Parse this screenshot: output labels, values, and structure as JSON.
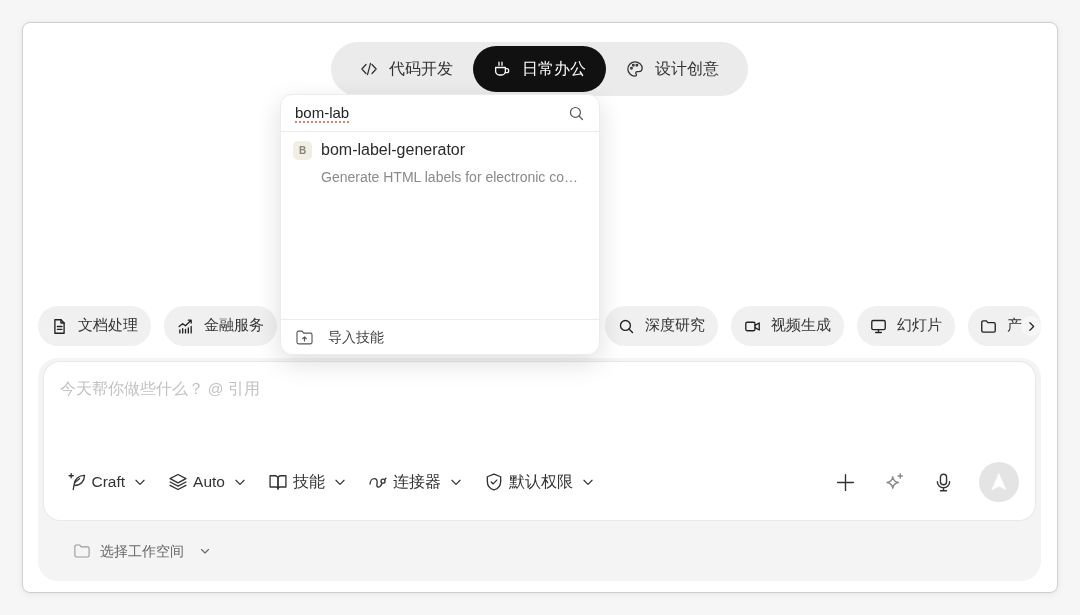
{
  "mode_tabs": [
    {
      "label": "代码开发",
      "selected": false
    },
    {
      "label": "日常办公",
      "selected": true
    },
    {
      "label": "设计创意",
      "selected": false
    }
  ],
  "category_chips": [
    {
      "label": "文档处理"
    },
    {
      "label": "金融服务"
    },
    {
      "label": "深度研究"
    },
    {
      "label": "视频生成"
    },
    {
      "label": "幻灯片"
    },
    {
      "label": "产"
    }
  ],
  "composer": {
    "placeholder": "今天帮你做些什么？ @ 引用",
    "toolbar": [
      {
        "label": "Craft"
      },
      {
        "label": "Auto"
      },
      {
        "label": "技能"
      },
      {
        "label": "连接器"
      },
      {
        "label": "默认权限"
      }
    ]
  },
  "workspace": {
    "label": "选择工作空间"
  },
  "skill_popup": {
    "search": {
      "value": "bom-lab"
    },
    "results": [
      {
        "initial": "B",
        "title": "bom-label-generator",
        "description": "Generate HTML labels for electronic co…"
      }
    ],
    "footer": {
      "label": "导入技能"
    }
  }
}
